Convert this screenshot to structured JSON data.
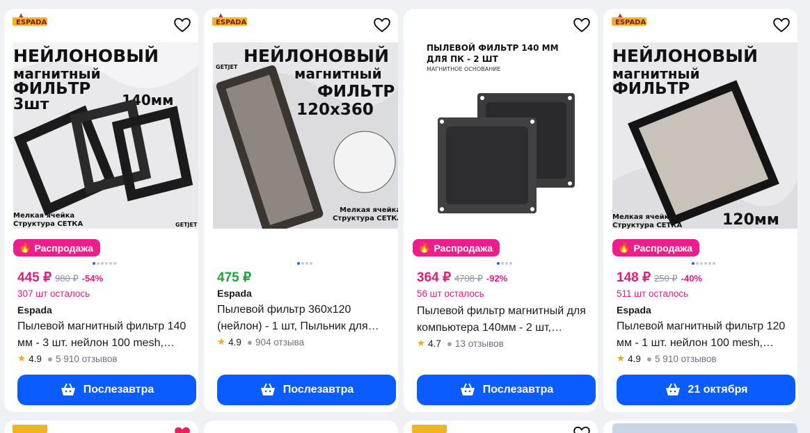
{
  "colors": {
    "accent": "#0a5cff",
    "sale": "#ec1e8c",
    "price": "#e11d7a",
    "price_green": "#20a437"
  },
  "cards": [
    {
      "has_logo": true,
      "sale_label": "Распродажа",
      "price": "445 ₽",
      "old_price": "980 ₽",
      "discount": "-54%",
      "stock": "307 шт осталось",
      "brand": "Espada",
      "title": "Пылевой магнитный фильтр 140 мм - 3 шт. нейлон 100 mesh,…",
      "rating": "4.9",
      "reviews": "5 910 отзывов",
      "button": "Послезавтра",
      "photo": {
        "line1": "НЕЙЛОНОВЫЙ",
        "line2": "магнитный",
        "line3": "ФИЛЬТР",
        "line4": "3шт",
        "size": "140мм",
        "note1": "Мелкая ячейка",
        "note2": "Структура СЕТКА",
        "maker": "GETJET"
      }
    },
    {
      "has_logo": true,
      "price": "475 ₽",
      "brand": "Espada",
      "title": "Пылевой фильтр 360x120 (нейлон) - 1 шт, Пыльник для…",
      "rating": "4.9",
      "reviews": "904 отзыва",
      "button": "Послезавтра",
      "photo": {
        "line1": "НЕЙЛОНОВЫЙ",
        "line2": "магнитный",
        "line3": "ФИЛЬТР",
        "size": "120x360",
        "note1": "Мелкая ячейка",
        "note2": "Структура СЕТКА",
        "maker": "GETJET"
      }
    },
    {
      "has_logo": false,
      "sale_label": "Распродажа",
      "price": "364 ₽",
      "old_price": "4708 ₽",
      "discount": "-92%",
      "stock": "56 шт осталось",
      "title": "Пылевой фильтр магнитный для компьютера 140мм - 2 шт,…",
      "rating": "4.7",
      "reviews": "13 отзывов",
      "button": "Послезавтра",
      "photo": {
        "line1": "ПЫЛЕВОЙ ФИЛЬТР 140 ММ",
        "line2": "ДЛЯ ПК - 2 ШТ",
        "line3": "МАГНИТНОЕ ОСНОВАНИЕ"
      }
    },
    {
      "has_logo": true,
      "sale_label": "Распродажа",
      "price": "148 ₽",
      "old_price": "250 ₽",
      "discount": "-40%",
      "stock": "511 шт осталось",
      "brand": "Espada",
      "title": "Пылевой магнитный фильтр 120 мм - 1 шт. нейлон 100 mesh,…",
      "rating": "4.9",
      "reviews": "5 910 отзывов",
      "button": "21 октября",
      "photo": {
        "line1": "НЕЙЛОНОВЫЙ",
        "line2": "магнитный",
        "line3": "ФИЛЬТР",
        "size": "120мм",
        "note1": "Мелкая ячейка",
        "note2": "Структура СЕТКА"
      }
    }
  ],
  "logo_text": "ESPADA"
}
